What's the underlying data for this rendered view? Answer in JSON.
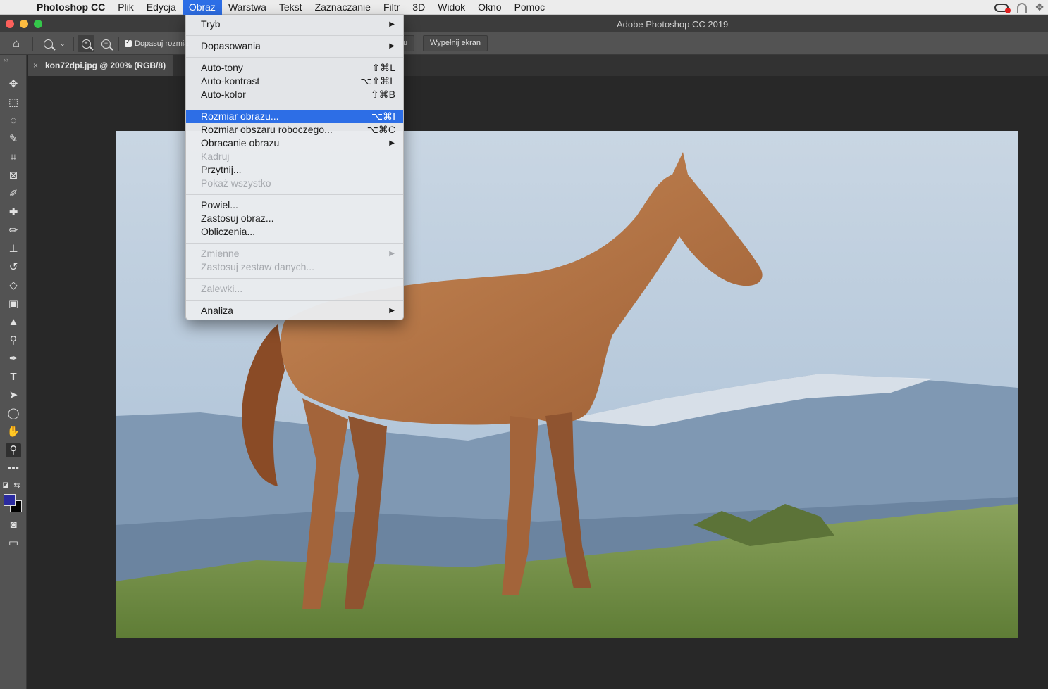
{
  "menubar": {
    "app_name": "Photoshop CC",
    "items": [
      "Plik",
      "Edycja",
      "Obraz",
      "Warstwa",
      "Tekst",
      "Zaznaczanie",
      "Filtr",
      "3D",
      "Widok",
      "Okno",
      "Pomoc"
    ],
    "active_item": "Obraz"
  },
  "window": {
    "title": "Adobe Photoshop CC 2019"
  },
  "options_bar": {
    "checkbox_label": "Dopasuj rozmia",
    "partial_button": "u",
    "fill_screen_button": "Wypełnij ekran"
  },
  "document_tab": {
    "label": "kon72dpi.jpg @ 200% (RGB/8)",
    "close": "×"
  },
  "image_menu": {
    "tryb": "Tryb",
    "dopasowania": "Dopasowania",
    "auto_tony": "Auto-tony",
    "auto_tony_sc": "⇧⌘L",
    "auto_kontrast": "Auto-kontrast",
    "auto_kontrast_sc": "⌥⇧⌘L",
    "auto_kolor": "Auto-kolor",
    "auto_kolor_sc": "⇧⌘B",
    "rozmiar_obrazu": "Rozmiar obrazu...",
    "rozmiar_obrazu_sc": "⌥⌘I",
    "rozmiar_obszaru": "Rozmiar obszaru roboczego...",
    "rozmiar_obszaru_sc": "⌥⌘C",
    "obracanie": "Obracanie obrazu",
    "kadruj": "Kadruj",
    "przytnij": "Przytnij...",
    "pokaz": "Pokaż wszystko",
    "powiel": "Powiel...",
    "zastosuj_obraz": "Zastosuj obraz...",
    "obliczenia": "Obliczenia...",
    "zmienne": "Zmienne",
    "zastosuj_zestaw": "Zastosuj zestaw danych...",
    "zalewki": "Zalewki...",
    "analiza": "Analiza",
    "highlighted": "Rozmiar obrazu..."
  },
  "colors": {
    "menu_highlight": "#2d6ee6",
    "foreground_swatch": "#2a2aa0",
    "background_swatch": "#000000"
  },
  "icons": [
    "apple-icon",
    "creative-cloud-icon",
    "home-icon",
    "zoom-tool-icon",
    "zoom-in-icon",
    "zoom-out-icon",
    "move-tool-icon",
    "marquee-tool-icon",
    "lasso-tool-icon",
    "quick-selection-icon",
    "crop-tool-icon",
    "frame-tool-icon",
    "eyedropper-icon",
    "healing-brush-icon",
    "brush-tool-icon",
    "stamp-tool-icon",
    "history-brush-icon",
    "eraser-icon",
    "gradient-icon",
    "blur-tool-icon",
    "dodge-tool-icon",
    "pen-tool-icon",
    "type-tool-icon",
    "path-selection-icon",
    "ellipse-tool-icon",
    "hand-tool-icon",
    "more-tools-icon"
  ]
}
